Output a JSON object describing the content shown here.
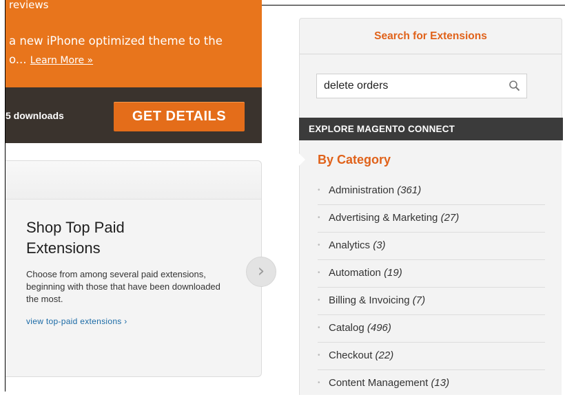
{
  "promo": {
    "label": "reviews",
    "text": "a new iPhone optimized theme to the",
    "text2": "o...",
    "learn_more": "Learn More »",
    "downloads": "5 downloads",
    "details_button": "GET DETAILS"
  },
  "shop": {
    "title": "Shop Top Paid Extensions",
    "description": "Choose from among several paid extensions, beginning with those that have been downloaded the most.",
    "link": "view top-paid extensions ›",
    "arrow": "›"
  },
  "sidebar": {
    "search_title": "Search for Extensions",
    "search_value": "delete orders",
    "explore_title": "EXPLORE MAGENTO CONNECT",
    "category_title": "By Category",
    "categories": [
      {
        "name": "Administration",
        "count": "(361)"
      },
      {
        "name": "Advertising & Marketing",
        "count": "(27)"
      },
      {
        "name": "Analytics",
        "count": "(3)"
      },
      {
        "name": "Automation",
        "count": "(19)"
      },
      {
        "name": "Billing & Invoicing",
        "count": "(7)"
      },
      {
        "name": "Catalog",
        "count": "(496)"
      },
      {
        "name": "Checkout",
        "count": "(22)"
      },
      {
        "name": "Content Management",
        "count": "(13)"
      }
    ]
  }
}
